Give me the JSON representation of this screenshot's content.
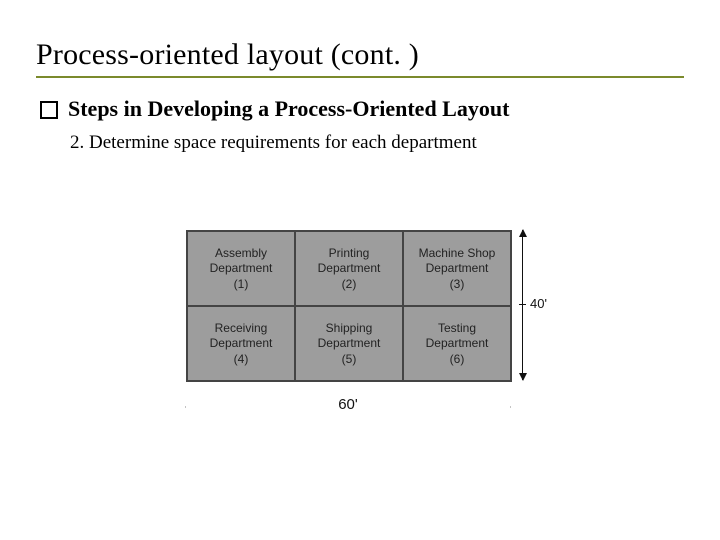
{
  "title": "Process-oriented layout (cont. )",
  "bullet": "Steps in Developing a Process-Oriented Layout",
  "subpoint": "2. Determine space requirements for each department",
  "grid": {
    "cells": [
      {
        "name": "Assembly",
        "dept": "Department",
        "num": "(1)"
      },
      {
        "name": "Printing",
        "dept": "Department",
        "num": "(2)"
      },
      {
        "name": "Machine Shop",
        "dept": "Department",
        "num": "(3)"
      },
      {
        "name": "Receiving",
        "dept": "Department",
        "num": "(4)"
      },
      {
        "name": "Shipping",
        "dept": "Department",
        "num": "(5)"
      },
      {
        "name": "Testing",
        "dept": "Department",
        "num": "(6)"
      }
    ]
  },
  "dims": {
    "width_label": "60'",
    "height_label": "40'"
  }
}
